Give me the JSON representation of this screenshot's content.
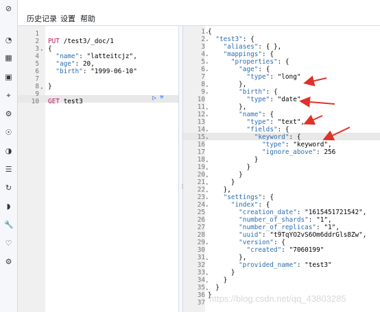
{
  "menu": {
    "history": "历史记录",
    "settings": "设置",
    "help": "帮助"
  },
  "sidebar_icons": [
    "compass-icon",
    "gauge-icon",
    "dashboard-icon",
    "canvas-icon",
    "maps-icon",
    "ml-icon",
    "graph-icon",
    "apm-icon",
    "logs-icon",
    "uptime-icon",
    "signal-icon",
    "dev-tools-icon",
    "heartbeat-icon",
    "gear-icon"
  ],
  "request_editor": {
    "lines": [
      {
        "n": "1",
        "text": ""
      },
      {
        "n": "2",
        "text": "PUT /test3/_doc/1",
        "fold": false
      },
      {
        "n": "3",
        "text": "{",
        "fold": true
      },
      {
        "n": "4",
        "text": "  \"name\": \"latteitcjz\","
      },
      {
        "n": "5",
        "text": "  \"age\": 20,"
      },
      {
        "n": "6",
        "text": "  \"birth\": \"1999-06-10\""
      },
      {
        "n": "7",
        "text": ""
      },
      {
        "n": "8",
        "text": "}",
        "fold": true
      },
      {
        "n": "9",
        "text": ""
      },
      {
        "n": "10",
        "text": "GET test3"
      }
    ],
    "play_icon": "▷",
    "wrench_icon": "🔧"
  },
  "response_editor": {
    "lines": [
      {
        "n": "1",
        "text": "{"
      },
      {
        "n": "2",
        "text": "  \"test3\" : {"
      },
      {
        "n": "3",
        "text": "    \"aliases\" : { },"
      },
      {
        "n": "4",
        "text": "    \"mappings\" : {"
      },
      {
        "n": "5",
        "text": "      \"properties\" : {"
      },
      {
        "n": "6",
        "text": "        \"age\" : {"
      },
      {
        "n": "7",
        "text": "          \"type\" : \"long\""
      },
      {
        "n": "8",
        "text": "        },"
      },
      {
        "n": "9",
        "text": "        \"birth\" : {"
      },
      {
        "n": "10",
        "text": "          \"type\" : \"date\""
      },
      {
        "n": "11",
        "text": "        },"
      },
      {
        "n": "12",
        "text": "        \"name\" : {"
      },
      {
        "n": "13",
        "text": "          \"type\" : \"text\","
      },
      {
        "n": "14",
        "text": "          \"fields\" : {"
      },
      {
        "n": "15",
        "text": "            \"keyword\" : {"
      },
      {
        "n": "16",
        "text": "              \"type\" : \"keyword\","
      },
      {
        "n": "17",
        "text": "              \"ignore_above\" : 256"
      },
      {
        "n": "18",
        "text": "            }"
      },
      {
        "n": "19",
        "text": "          }"
      },
      {
        "n": "20",
        "text": "        }"
      },
      {
        "n": "21",
        "text": "      }"
      },
      {
        "n": "22",
        "text": "    },"
      },
      {
        "n": "23",
        "text": "    \"settings\" : {"
      },
      {
        "n": "24",
        "text": "      \"index\" : {"
      },
      {
        "n": "25",
        "text": "        \"creation_date\" : \"1615451721542\","
      },
      {
        "n": "26",
        "text": "        \"number_of_shards\" : \"1\","
      },
      {
        "n": "27",
        "text": "        \"number_of_replicas\" : \"1\","
      },
      {
        "n": "28",
        "text": "        \"uuid\" : \"t9TqYO2vS6Om6ddrGls8Zw\","
      },
      {
        "n": "29",
        "text": "        \"version\" : {"
      },
      {
        "n": "30",
        "text": "          \"created\" : \"7060199\""
      },
      {
        "n": "31",
        "text": "        },"
      },
      {
        "n": "32",
        "text": "        \"provided_name\" : \"test3\""
      },
      {
        "n": "33",
        "text": "      }"
      },
      {
        "n": "34",
        "text": "    }"
      },
      {
        "n": "35",
        "text": "  }"
      },
      {
        "n": "36",
        "text": "}"
      },
      {
        "n": "37",
        "text": ""
      }
    ]
  },
  "watermark": "https://blog.csdn.net/qq_43803285",
  "colors": {
    "arrow": "#e0312a",
    "highlight": "#e8e8e8",
    "gutter": "#f0f0f0"
  }
}
